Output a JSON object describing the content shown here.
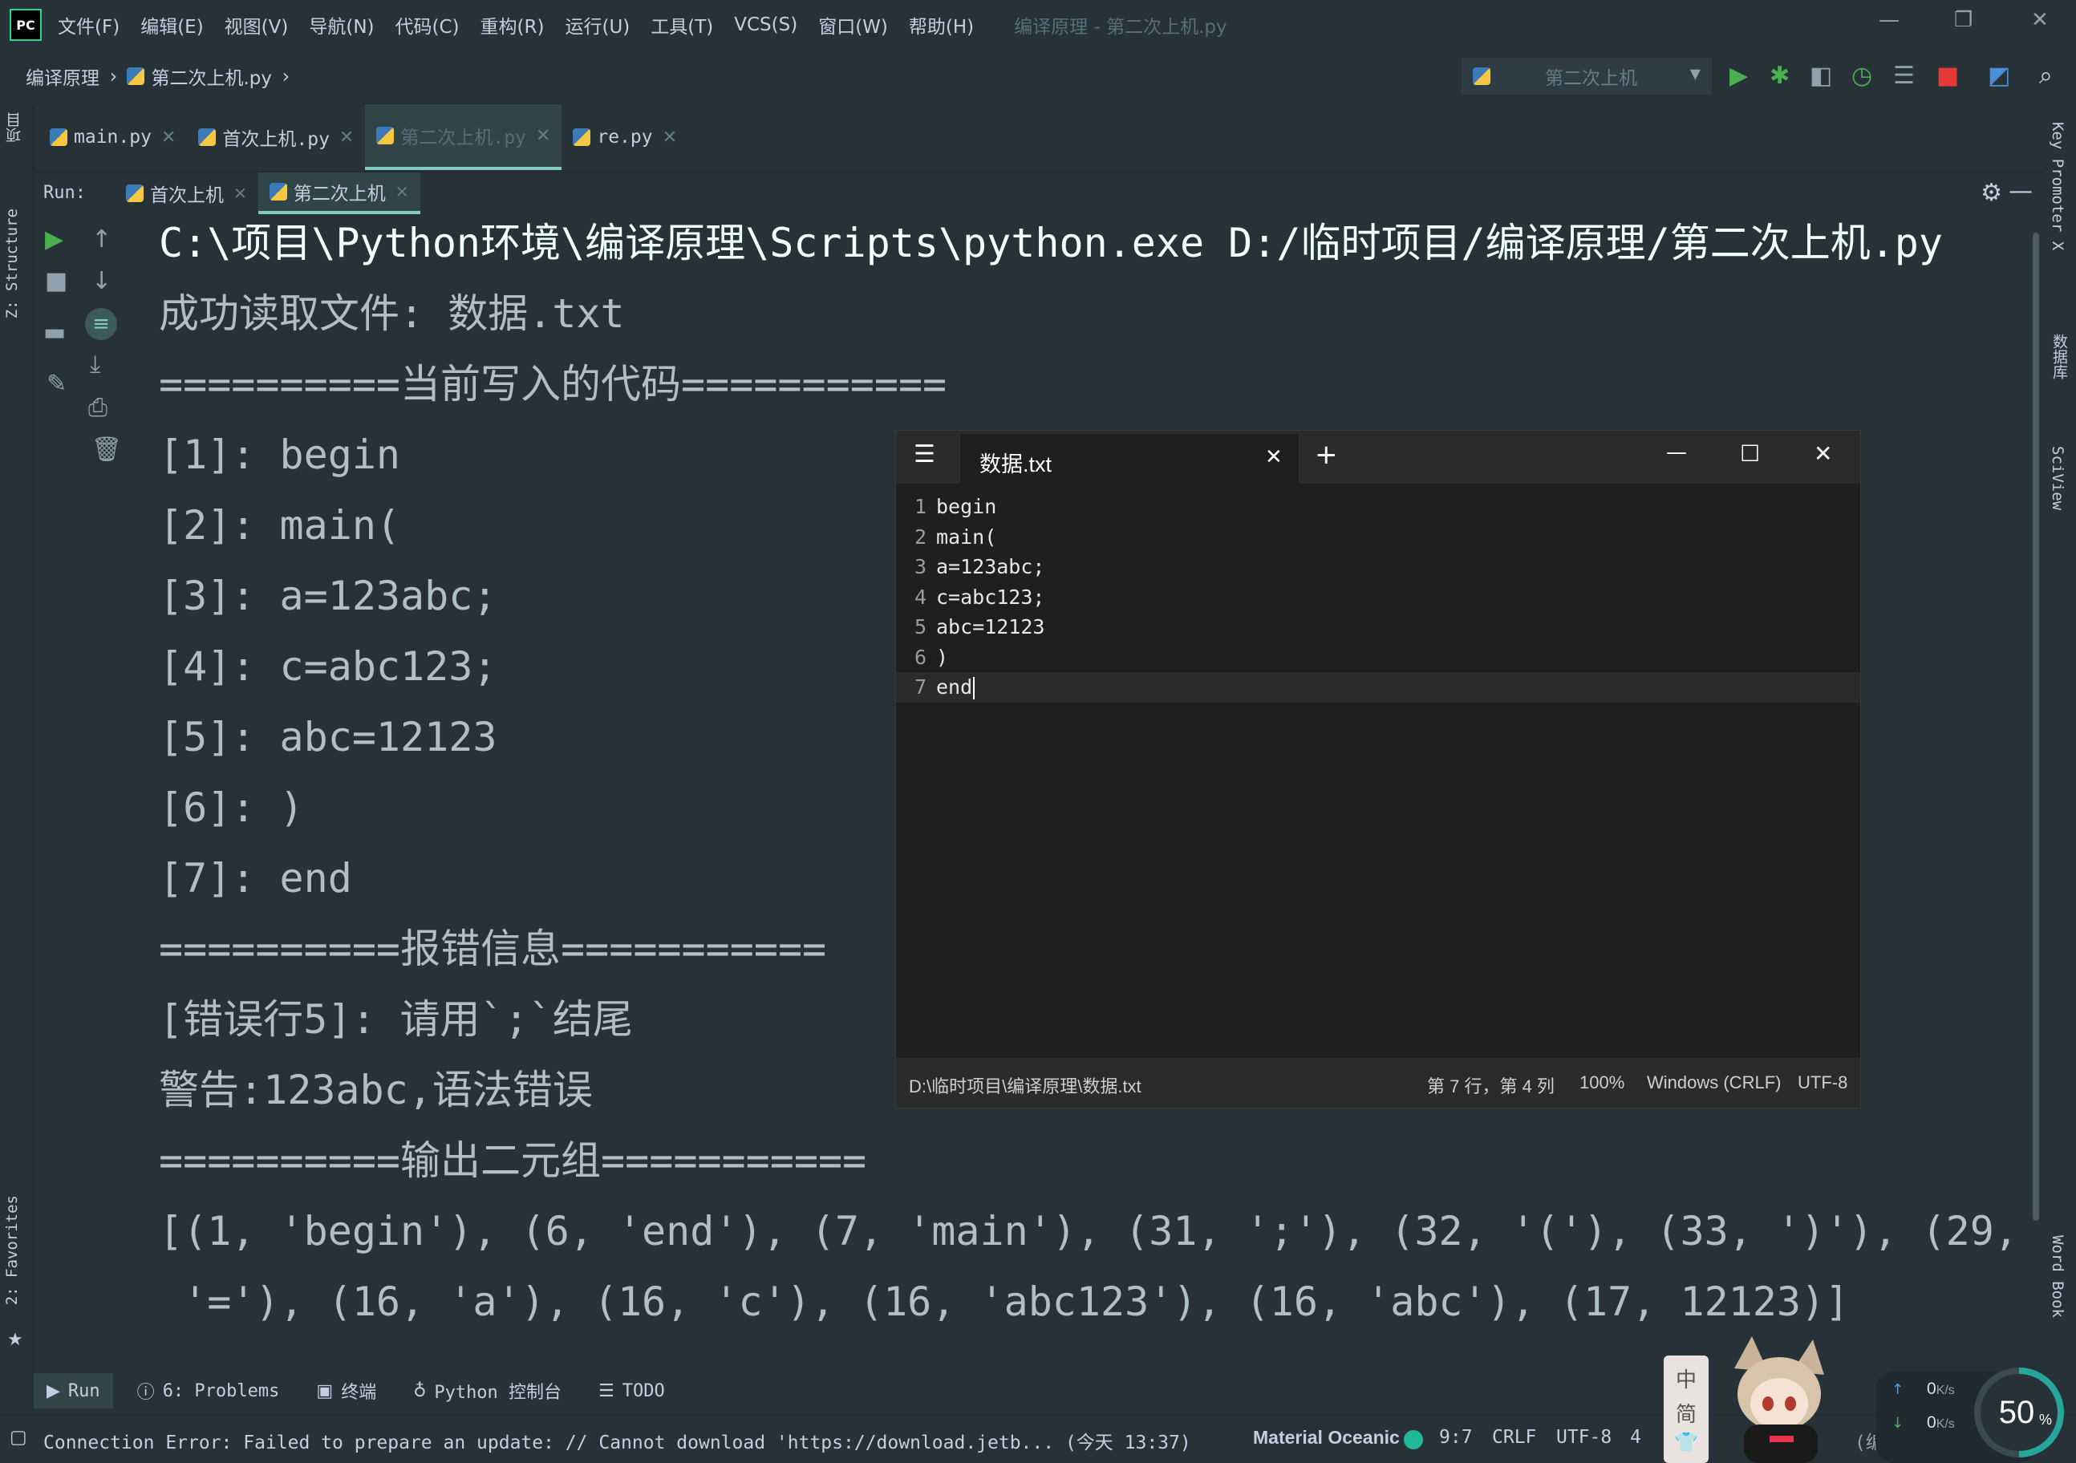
{
  "menubar": {
    "logo": "PC",
    "items": [
      "文件(F)",
      "编辑(E)",
      "视图(V)",
      "导航(N)",
      "代码(C)",
      "重构(R)",
      "运行(U)",
      "工具(T)",
      "VCS(S)",
      "窗口(W)",
      "帮助(H)"
    ],
    "window_title": "编译原理 - 第二次上机.py"
  },
  "breadcrumb": {
    "project": "编译原理",
    "file": "第二次上机.py"
  },
  "run_config": {
    "label": "第二次上机"
  },
  "editor_tabs": [
    {
      "label": "main.py",
      "active": false
    },
    {
      "label": "首次上机.py",
      "active": false
    },
    {
      "label": "第二次上机.py",
      "active": true
    },
    {
      "label": "re.py",
      "active": false
    }
  ],
  "left_strip": {
    "project": "项目",
    "structure": "Z: Structure",
    "favorites": "2: Favorites"
  },
  "right_strip": {
    "key_promoter": "Key Promoter X",
    "database": "数据库",
    "sciview": "SciView",
    "word_book": "Word Book"
  },
  "run_panel": {
    "label": "Run:",
    "tabs": [
      {
        "label": "首次上机",
        "active": false
      },
      {
        "label": "第二次上机",
        "active": true
      }
    ]
  },
  "console": {
    "lines": [
      "C:\\项目\\Python环境\\编译原理\\Scripts\\python.exe D:/临时项目/编译原理/第二次上机.py",
      "成功读取文件: 数据.txt",
      "==========当前写入的代码===========",
      "[1]: begin",
      "[2]: main(",
      "[3]: a=123abc;",
      "[4]: c=abc123;",
      "[5]: abc=12123",
      "[6]: )",
      "[7]: end",
      "==========报错信息===========",
      "[错误行5]: 请用`;`结尾",
      "警告:123abc,语法错误",
      "==========输出二元组===========",
      "[(1, 'begin'), (6, 'end'), (7, 'main'), (31, ';'), (32, '('), (33, ')'), (29,",
      " '='), (16, 'a'), (16, 'c'), (16, 'abc123'), (16, 'abc'), (17, 12123)]"
    ]
  },
  "notepad": {
    "tab_title": "数据.txt",
    "lines": [
      {
        "num": "1",
        "text": "begin"
      },
      {
        "num": "2",
        "text": "main("
      },
      {
        "num": "3",
        "text": "a=123abc;"
      },
      {
        "num": "4",
        "text": "c=abc123;"
      },
      {
        "num": "5",
        "text": "abc=12123"
      },
      {
        "num": "6",
        "text": ")"
      },
      {
        "num": "7",
        "text": "end"
      }
    ],
    "status": {
      "path": "D:\\临时项目\\编译原理\\数据.txt",
      "position": "第 7 行，第 4 列",
      "zoom": "100%",
      "line_ending": "Windows (CRLF)",
      "encoding": "UTF-8"
    }
  },
  "tool_windows": [
    {
      "label": "Run",
      "icon": "play-icon",
      "active": true
    },
    {
      "label": "6: Problems",
      "icon": "info-icon",
      "active": false
    },
    {
      "label": "终端",
      "icon": "terminal-icon",
      "active": false
    },
    {
      "label": "Python 控制台",
      "icon": "python-icon",
      "active": false
    },
    {
      "label": "TODO",
      "icon": "list-icon",
      "active": false
    }
  ],
  "statusbar": {
    "message": "Connection Error: Failed to prepare an update: // Cannot download 'https://download.jetb... (今天 13:37)",
    "theme": "Material Oceanic",
    "position": "9:7",
    "line_ending": "CRLF",
    "encoding": "UTF-8",
    "indent": "4",
    "project": "(编译原理)"
  },
  "ime_widget": {
    "char_top": "中",
    "char_bottom": "简"
  },
  "speed_widget": {
    "upload": "0",
    "download": "0",
    "unit": "K/s",
    "percent": "50",
    "percent_sign": "%"
  },
  "colors": {
    "bg": "#263238",
    "accent": "#80cbc4",
    "run_green": "#4caf50",
    "stop_red": "#e53935",
    "notepad_bg": "#1f1f1f"
  }
}
